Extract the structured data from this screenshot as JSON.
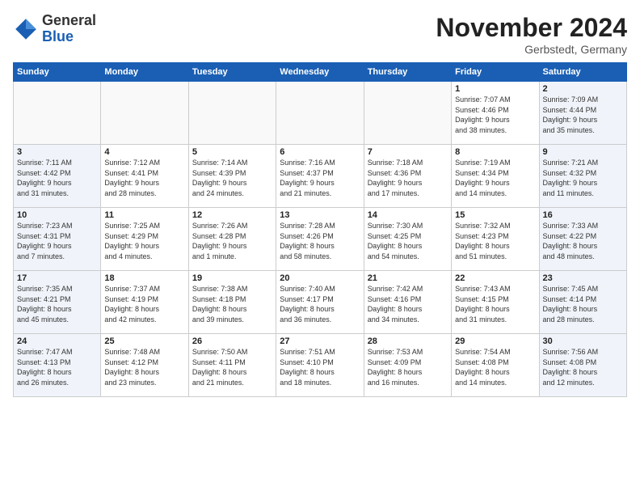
{
  "logo": {
    "general": "General",
    "blue": "Blue"
  },
  "header": {
    "month": "November 2024",
    "location": "Gerbstedt, Germany"
  },
  "weekdays": [
    "Sunday",
    "Monday",
    "Tuesday",
    "Wednesday",
    "Thursday",
    "Friday",
    "Saturday"
  ],
  "weeks": [
    [
      {
        "day": "",
        "info": ""
      },
      {
        "day": "",
        "info": ""
      },
      {
        "day": "",
        "info": ""
      },
      {
        "day": "",
        "info": ""
      },
      {
        "day": "",
        "info": ""
      },
      {
        "day": "1",
        "info": "Sunrise: 7:07 AM\nSunset: 4:46 PM\nDaylight: 9 hours\nand 38 minutes."
      },
      {
        "day": "2",
        "info": "Sunrise: 7:09 AM\nSunset: 4:44 PM\nDaylight: 9 hours\nand 35 minutes."
      }
    ],
    [
      {
        "day": "3",
        "info": "Sunrise: 7:11 AM\nSunset: 4:42 PM\nDaylight: 9 hours\nand 31 minutes."
      },
      {
        "day": "4",
        "info": "Sunrise: 7:12 AM\nSunset: 4:41 PM\nDaylight: 9 hours\nand 28 minutes."
      },
      {
        "day": "5",
        "info": "Sunrise: 7:14 AM\nSunset: 4:39 PM\nDaylight: 9 hours\nand 24 minutes."
      },
      {
        "day": "6",
        "info": "Sunrise: 7:16 AM\nSunset: 4:37 PM\nDaylight: 9 hours\nand 21 minutes."
      },
      {
        "day": "7",
        "info": "Sunrise: 7:18 AM\nSunset: 4:36 PM\nDaylight: 9 hours\nand 17 minutes."
      },
      {
        "day": "8",
        "info": "Sunrise: 7:19 AM\nSunset: 4:34 PM\nDaylight: 9 hours\nand 14 minutes."
      },
      {
        "day": "9",
        "info": "Sunrise: 7:21 AM\nSunset: 4:32 PM\nDaylight: 9 hours\nand 11 minutes."
      }
    ],
    [
      {
        "day": "10",
        "info": "Sunrise: 7:23 AM\nSunset: 4:31 PM\nDaylight: 9 hours\nand 7 minutes."
      },
      {
        "day": "11",
        "info": "Sunrise: 7:25 AM\nSunset: 4:29 PM\nDaylight: 9 hours\nand 4 minutes."
      },
      {
        "day": "12",
        "info": "Sunrise: 7:26 AM\nSunset: 4:28 PM\nDaylight: 9 hours\nand 1 minute."
      },
      {
        "day": "13",
        "info": "Sunrise: 7:28 AM\nSunset: 4:26 PM\nDaylight: 8 hours\nand 58 minutes."
      },
      {
        "day": "14",
        "info": "Sunrise: 7:30 AM\nSunset: 4:25 PM\nDaylight: 8 hours\nand 54 minutes."
      },
      {
        "day": "15",
        "info": "Sunrise: 7:32 AM\nSunset: 4:23 PM\nDaylight: 8 hours\nand 51 minutes."
      },
      {
        "day": "16",
        "info": "Sunrise: 7:33 AM\nSunset: 4:22 PM\nDaylight: 8 hours\nand 48 minutes."
      }
    ],
    [
      {
        "day": "17",
        "info": "Sunrise: 7:35 AM\nSunset: 4:21 PM\nDaylight: 8 hours\nand 45 minutes."
      },
      {
        "day": "18",
        "info": "Sunrise: 7:37 AM\nSunset: 4:19 PM\nDaylight: 8 hours\nand 42 minutes."
      },
      {
        "day": "19",
        "info": "Sunrise: 7:38 AM\nSunset: 4:18 PM\nDaylight: 8 hours\nand 39 minutes."
      },
      {
        "day": "20",
        "info": "Sunrise: 7:40 AM\nSunset: 4:17 PM\nDaylight: 8 hours\nand 36 minutes."
      },
      {
        "day": "21",
        "info": "Sunrise: 7:42 AM\nSunset: 4:16 PM\nDaylight: 8 hours\nand 34 minutes."
      },
      {
        "day": "22",
        "info": "Sunrise: 7:43 AM\nSunset: 4:15 PM\nDaylight: 8 hours\nand 31 minutes."
      },
      {
        "day": "23",
        "info": "Sunrise: 7:45 AM\nSunset: 4:14 PM\nDaylight: 8 hours\nand 28 minutes."
      }
    ],
    [
      {
        "day": "24",
        "info": "Sunrise: 7:47 AM\nSunset: 4:13 PM\nDaylight: 8 hours\nand 26 minutes."
      },
      {
        "day": "25",
        "info": "Sunrise: 7:48 AM\nSunset: 4:12 PM\nDaylight: 8 hours\nand 23 minutes."
      },
      {
        "day": "26",
        "info": "Sunrise: 7:50 AM\nSunset: 4:11 PM\nDaylight: 8 hours\nand 21 minutes."
      },
      {
        "day": "27",
        "info": "Sunrise: 7:51 AM\nSunset: 4:10 PM\nDaylight: 8 hours\nand 18 minutes."
      },
      {
        "day": "28",
        "info": "Sunrise: 7:53 AM\nSunset: 4:09 PM\nDaylight: 8 hours\nand 16 minutes."
      },
      {
        "day": "29",
        "info": "Sunrise: 7:54 AM\nSunset: 4:08 PM\nDaylight: 8 hours\nand 14 minutes."
      },
      {
        "day": "30",
        "info": "Sunrise: 7:56 AM\nSunset: 4:08 PM\nDaylight: 8 hours\nand 12 minutes."
      }
    ]
  ]
}
